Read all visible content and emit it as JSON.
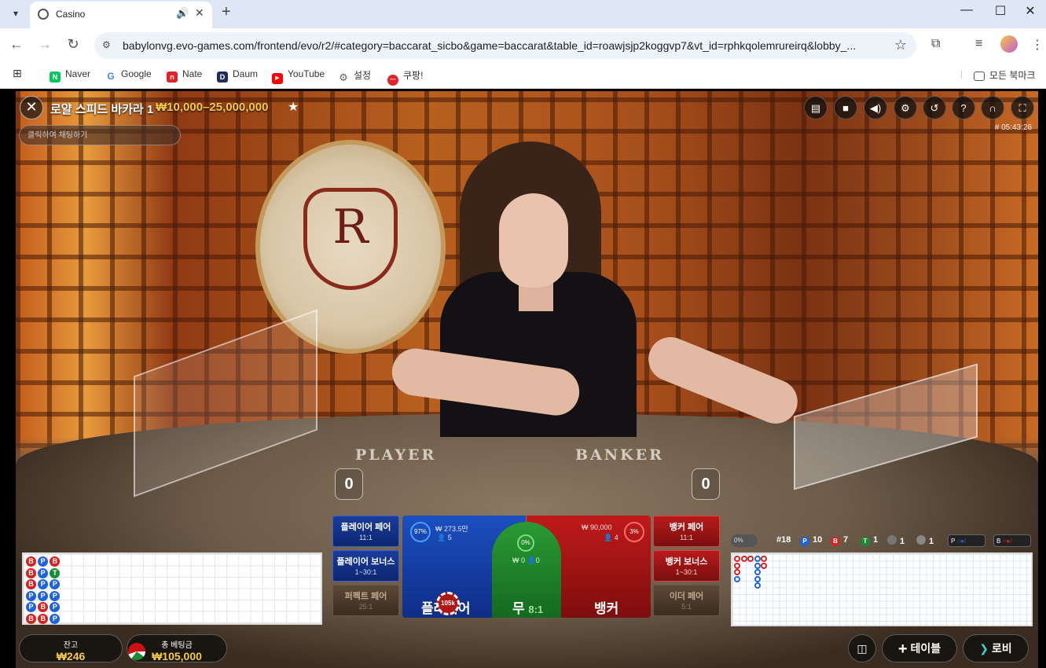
{
  "browser": {
    "tab_title": "Casino",
    "url": "babylonvg.evo-games.com/frontend/evo/r2/#category=baccarat_sicbo&game=baccarat&table_id=roawjsjp2koggvp7&vt_id=rphkqolemrureirq&lobby_...",
    "bookmarks": [
      {
        "label": "Naver",
        "color": "#03c75a",
        "glyph": "N"
      },
      {
        "label": "Google",
        "color": "#4285f4",
        "glyph": "G"
      },
      {
        "label": "Nate",
        "color": "#e2242a",
        "glyph": "n"
      },
      {
        "label": "Daum",
        "color": "#1f2c5c",
        "glyph": "D"
      },
      {
        "label": "YouTube",
        "color": "#ff0000",
        "glyph": "▶"
      },
      {
        "label": "설정",
        "color": "#5f6368",
        "glyph": "⚙"
      },
      {
        "label": "쿠팡!",
        "color": "#e2242a",
        "glyph": "●"
      }
    ],
    "all_bookmarks": "모든 북마크"
  },
  "game": {
    "table_title": "로얄 스피드 바카라 1",
    "limits": "₩10,000–25,000,000",
    "chat_placeholder": "클릭하여 채팅하기",
    "round_id": "# 05:43:26",
    "felt_player": "PLAYER",
    "felt_banker": "BANKER",
    "player_score": "0",
    "banker_score": "0",
    "toolbar_icons": [
      "chat-icon",
      "video-icon",
      "volume-icon",
      "settings-icon",
      "history-icon",
      "help-icon",
      "headset-icon",
      "fullscreen-icon"
    ]
  },
  "road_left": {
    "columns": [
      [
        "B",
        "B",
        "B",
        "P",
        "P",
        "B"
      ],
      [
        "P",
        "P",
        "P",
        "P",
        "B",
        "B"
      ],
      [
        "B",
        "T",
        "P",
        "P",
        "P",
        "P"
      ]
    ]
  },
  "bets": {
    "player_pair": {
      "label": "플레이어 페어",
      "odds": "11:1"
    },
    "player_bonus": {
      "label": "플레이어 보너스",
      "odds": "1~30:1"
    },
    "perfect_pair": {
      "label": "퍼펙트 페어",
      "odds": "25:1"
    },
    "banker_pair": {
      "label": "뱅커 페어",
      "odds": "11:1"
    },
    "banker_bonus": {
      "label": "뱅커 보너스",
      "odds": "1~30:1"
    },
    "either_pair": {
      "label": "이더 페어",
      "odds": "5:1"
    },
    "player": {
      "label": "플레이어",
      "amount": "₩ 273.5만",
      "players": "5",
      "pct": "97%"
    },
    "tie": {
      "label": "무",
      "odds": "8:1",
      "amount": "₩ 0",
      "players": "0",
      "pct": "0%"
    },
    "banker": {
      "label": "뱅커",
      "amount": "₩ 90,000",
      "players": "4",
      "pct": "3%"
    },
    "chip_value": "105k"
  },
  "road_stats": {
    "pct_toggle": "0%",
    "round": "#18",
    "player": "10",
    "banker": "7",
    "tie": "1",
    "player_pair_count": "1",
    "banker_pair_count": "1",
    "player_predict": "P",
    "banker_predict": "B"
  },
  "bottom": {
    "balance_label": "잔고",
    "balance": "₩246",
    "total_bet_label": "총 베팅금",
    "total_bet": "₩105,000",
    "tables_label": "테이블",
    "lobby_label": "로비"
  }
}
